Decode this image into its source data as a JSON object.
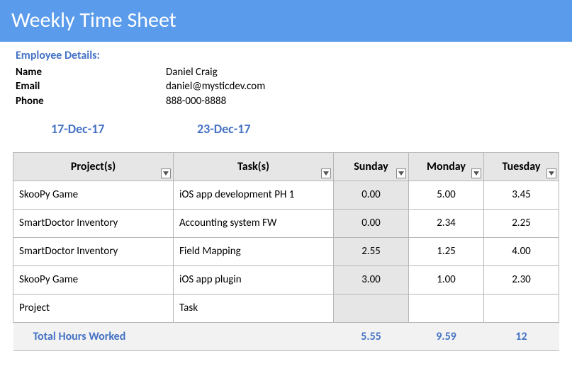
{
  "header": {
    "title": "Weekly Time Sheet"
  },
  "employee": {
    "heading": "Employee Details:",
    "name_label": "Name",
    "name_value": "Daniel Craig",
    "email_label": "Email",
    "email_value": "daniel@mysticdev.com",
    "phone_label": "Phone",
    "phone_value": "888-000-8888"
  },
  "dates": {
    "start": "17-Dec-17",
    "end": "23-Dec-17"
  },
  "table": {
    "columns": {
      "project": "Project(s)",
      "task": "Task(s)",
      "sunday": "Sunday",
      "monday": "Monday",
      "tuesday": "Tuesday"
    },
    "rows": [
      {
        "project": "SkooPy Game",
        "task": "iOS app development PH 1",
        "sunday": "0.00",
        "monday": "5.00",
        "tuesday": "3.45"
      },
      {
        "project": "SmartDoctor Inventory",
        "task": "Accounting system FW",
        "sunday": "0.00",
        "monday": "2.34",
        "tuesday": "2.25"
      },
      {
        "project": "SmartDoctor Inventory",
        "task": "Field Mapping",
        "sunday": "2.55",
        "monday": "1.25",
        "tuesday": "4.00"
      },
      {
        "project": "SkooPy Game",
        "task": "iOS app plugin",
        "sunday": "3.00",
        "monday": "1.00",
        "tuesday": "2.30"
      },
      {
        "project": "Project",
        "task": "Task",
        "sunday": "",
        "monday": "",
        "tuesday": ""
      }
    ],
    "totals": {
      "label": "Total Hours Worked",
      "sunday": "5.55",
      "monday": "9.59",
      "tuesday": "12"
    }
  }
}
